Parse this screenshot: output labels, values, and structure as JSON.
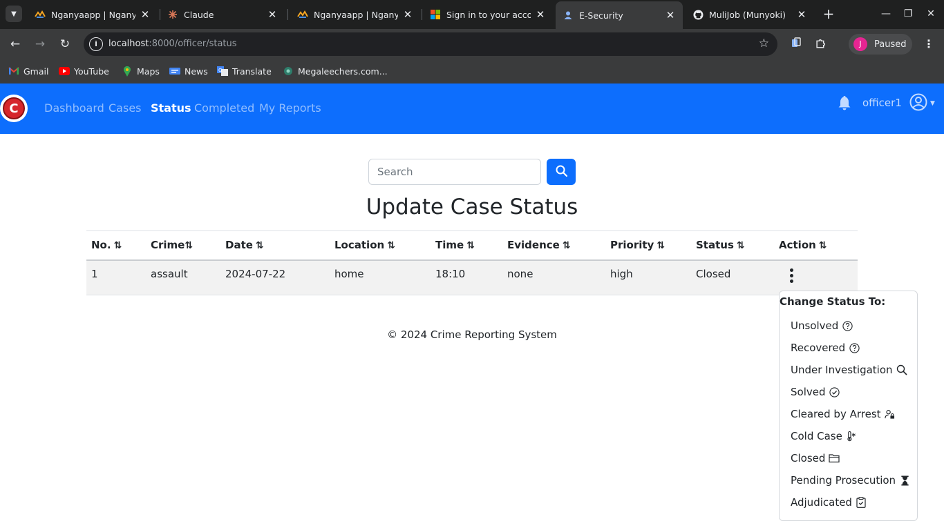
{
  "browser": {
    "tabs": [
      {
        "title": "Nganyaapp | Nganya",
        "icon": "nganya-favicon"
      },
      {
        "title": "Claude",
        "icon": "claude-favicon"
      },
      {
        "title": "Nganyaapp | Nganya",
        "icon": "nganya-favicon"
      },
      {
        "title": "Sign in to your acco",
        "icon": "microsoft-favicon"
      },
      {
        "title": "E-Security",
        "icon": "esecurity-favicon",
        "active": true
      },
      {
        "title": "MuliJob (Munyoki)",
        "icon": "github-favicon"
      }
    ],
    "url_host": "localhost",
    "url_path": ":8000/officer/status",
    "profile_initial": "J",
    "profile_status": "Paused",
    "bookmarks": [
      {
        "label": "Gmail",
        "icon": "gmail-icon"
      },
      {
        "label": "YouTube",
        "icon": "youtube-icon"
      },
      {
        "label": "Maps",
        "icon": "maps-icon"
      },
      {
        "label": "News",
        "icon": "news-icon"
      },
      {
        "label": "Translate",
        "icon": "translate-icon"
      },
      {
        "label": "Megaleechers.com...",
        "icon": "megaleechers-icon"
      }
    ]
  },
  "navbar": {
    "logo_letter": "C",
    "links": [
      "Dashboard",
      "Cases",
      "Status",
      "Completed",
      "My Reports"
    ],
    "active_link": "Status",
    "username": "officer1",
    "brand_color": "#0d6efd"
  },
  "search": {
    "placeholder": "Search",
    "button_icon": "search-icon"
  },
  "page": {
    "title": "Update Case Status"
  },
  "table": {
    "headers": [
      "No.",
      "Crime",
      "Date",
      "Location",
      "Time",
      "Evidence",
      "Priority",
      "Status",
      "Action"
    ],
    "sort_glyph": "⇅",
    "rows": [
      {
        "no": "1",
        "crime": "assault",
        "date": "2024-07-22",
        "location": "home",
        "time": "18:10",
        "evidence": "none",
        "priority": "high",
        "status": "Closed"
      }
    ]
  },
  "status_menu": {
    "header": "Change Status To:",
    "options": [
      {
        "label": "Unsolved",
        "icon": "question-circle-icon"
      },
      {
        "label": "Recovered",
        "icon": "question-circle-icon"
      },
      {
        "label": "Under Investigation",
        "icon": "search-icon"
      },
      {
        "label": "Solved",
        "icon": "check-circle-icon"
      },
      {
        "label": "Cleared by Arrest",
        "icon": "person-lock-icon"
      },
      {
        "label": "Cold Case",
        "icon": "thermometer-snow-icon"
      },
      {
        "label": "Closed",
        "icon": "folder-icon"
      },
      {
        "label": "Pending Prosecution",
        "icon": "hourglass-icon"
      },
      {
        "label": "Adjudicated",
        "icon": "clipboard-check-icon"
      }
    ]
  },
  "footer": {
    "text": "© 2024 Crime Reporting System"
  }
}
